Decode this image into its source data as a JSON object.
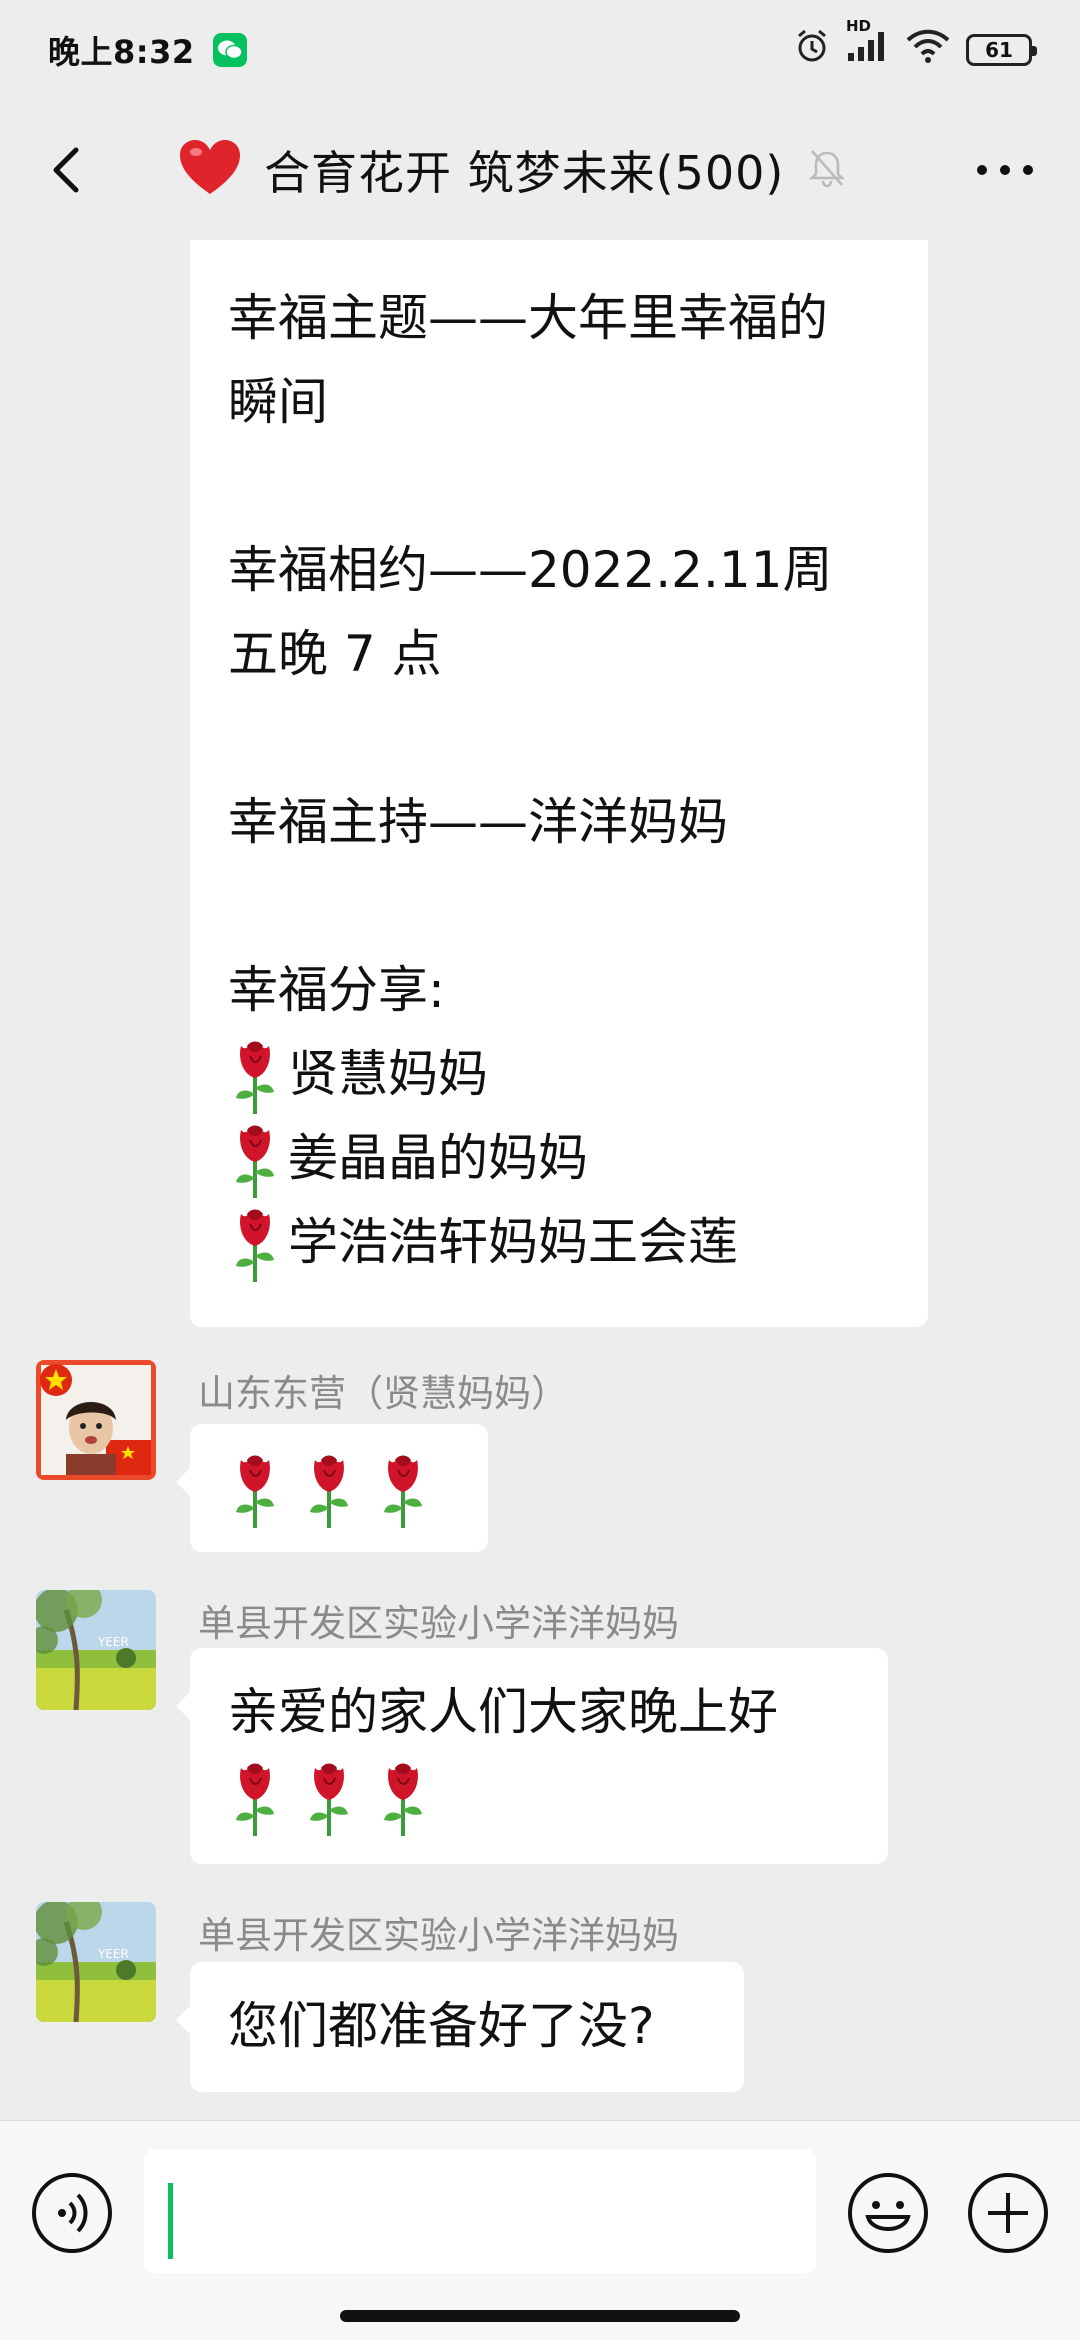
{
  "status_bar": {
    "time": "晚上8:32",
    "battery": "61",
    "network": "HD"
  },
  "header": {
    "title": "合育花开 筑梦未来(500)"
  },
  "messages": [
    {
      "id": "m1",
      "lines": [
        "幸福主题——大年里幸福的",
        "瞬间",
        "",
        "幸福相约——2022.2.11周",
        "五晚 7 点",
        "",
        "幸福主持——洋洋妈妈",
        "",
        "幸福分享:",
        "贤慧妈妈",
        "姜晶晶的妈妈",
        "学浩浩轩妈妈王会莲"
      ]
    },
    {
      "id": "m2",
      "sender": "山东东营（贤慧妈妈）",
      "roses": 3
    },
    {
      "id": "m3",
      "sender": "单县开发区实验小学洋洋妈妈",
      "text": "亲爱的家人们大家晚上好",
      "roses": 3
    },
    {
      "id": "m4",
      "sender": "单县开发区实验小学洋洋妈妈",
      "text": "您们都准备好了没?"
    }
  ],
  "colors": {
    "background": "#ededed",
    "bubble": "#ffffff",
    "accent": "#07c160",
    "heart": "#e0242b",
    "rose": "#d0152a"
  },
  "icons": {
    "back": "chevron-left-icon",
    "heart": "heart-icon",
    "mute": "bell-off-icon",
    "more": "more-icon",
    "voice": "voice-icon",
    "emoji": "emoji-icon",
    "plus": "plus-icon"
  }
}
